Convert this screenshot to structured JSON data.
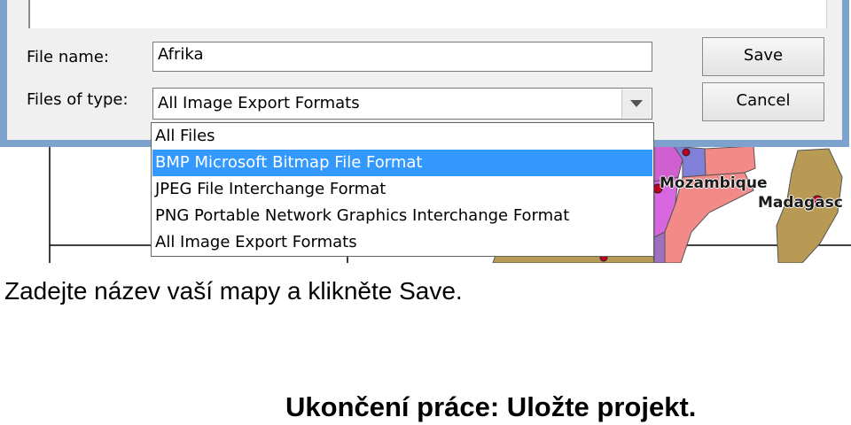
{
  "dialog": {
    "file_name_label": "File name:",
    "file_name_value": "Afrika",
    "file_type_label": "Files of type:",
    "file_type_selected": "All Image Export Formats",
    "save_button": "Save",
    "cancel_button": "Cancel",
    "file_type_options": [
      {
        "label": "All Files",
        "selected": false
      },
      {
        "label": "BMP Microsoft Bitmap File Format",
        "selected": true
      },
      {
        "label": "JPEG File Interchange Format",
        "selected": false
      },
      {
        "label": "PNG Portable Network Graphics Interchange Format",
        "selected": false
      },
      {
        "label": "All Image Export Formats",
        "selected": false
      }
    ],
    "selection_color": "#3399ff"
  },
  "map": {
    "labels": [
      "Mozambique",
      "Madagasc"
    ]
  },
  "slide": {
    "caption": "Zadejte název vaší mapy a klikněte Save.",
    "footer": "Ukončení práce: Uložte projekt."
  }
}
